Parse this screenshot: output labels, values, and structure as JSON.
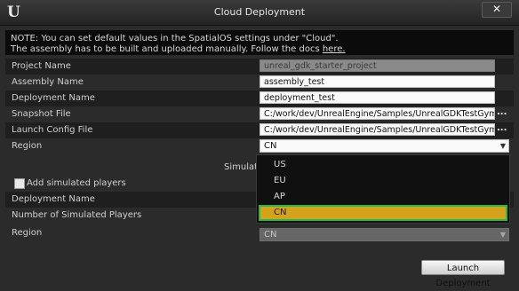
{
  "window": {
    "title": "Cloud Deployment",
    "close_label": "✕",
    "logo_glyph": "U"
  },
  "notice": {
    "line1": "NOTE: You can set default values in the SpatialOS settings under \"Cloud\".",
    "line2_prefix": "The assembly has to be built and uploaded manually. Follow the docs ",
    "link_text": "here."
  },
  "fields": {
    "project_name": {
      "label": "Project Name",
      "value": "unreal_gdk_starter_project"
    },
    "assembly_name": {
      "label": "Assembly Name",
      "value": "assembly_test"
    },
    "deployment_name": {
      "label": "Deployment Name",
      "value": "deployment_test"
    },
    "snapshot_file": {
      "label": "Snapshot File",
      "value": "C:/work/dev/UnrealEngine/Samples/UnrealGDKTestGyms/",
      "browse": "..."
    },
    "launch_config_file": {
      "label": "Launch Config File",
      "value": "C:/work/dev/UnrealEngine/Samples/UnrealGDKTestGyms/",
      "browse": "..."
    },
    "region": {
      "label": "Region",
      "value": "CN"
    }
  },
  "simulated": {
    "section_title": "Simulate",
    "add_label": "Add simulated players",
    "deployment_name_label": "Deployment Name",
    "num_players_label": "Number of Simulated Players",
    "region_label": "Region",
    "region_value": "CN"
  },
  "region_dropdown": {
    "options": [
      "US",
      "EU",
      "AP",
      "CN"
    ],
    "selected": "CN"
  },
  "actions": {
    "launch_label": "Launch Deployment"
  },
  "colors": {
    "selected_option": "#d5a21c",
    "selected_outline": "#29b84e",
    "window_bg": "#2b2b2b"
  }
}
